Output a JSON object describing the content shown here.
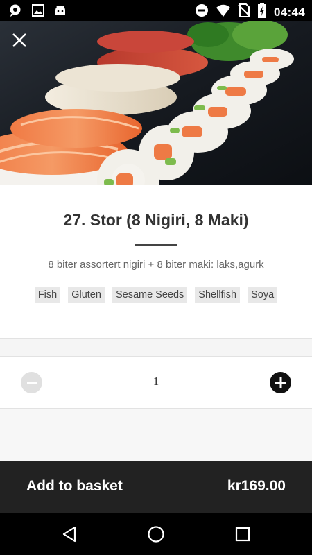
{
  "status_bar": {
    "time": "04:44",
    "left_icons": [
      "chat-bubble-icon",
      "image-icon",
      "android-icon"
    ],
    "right_icons": [
      "do-not-disturb-icon",
      "wifi-icon",
      "no-sim-icon",
      "battery-charging-icon"
    ]
  },
  "product": {
    "image": "sushi-platter-photo",
    "title": "27. Stor (8 Nigiri, 8 Maki)",
    "description": "8 biter assortert nigiri + 8 biter maki: laks,agurk",
    "allergens": [
      "Fish",
      "Gluten",
      "Sesame Seeds",
      "Shellfish",
      "Soya"
    ]
  },
  "quantity": {
    "value": "1",
    "decrement_icon": "minus-icon",
    "increment_icon": "plus-icon"
  },
  "basket": {
    "label": "Add to basket",
    "price": "kr169.00"
  },
  "nav": {
    "icons": [
      "back-icon",
      "home-icon",
      "recents-icon"
    ]
  },
  "colors": {
    "basket_bar": "#222222",
    "chip_bg": "#e8e8e8",
    "title": "#333333"
  }
}
